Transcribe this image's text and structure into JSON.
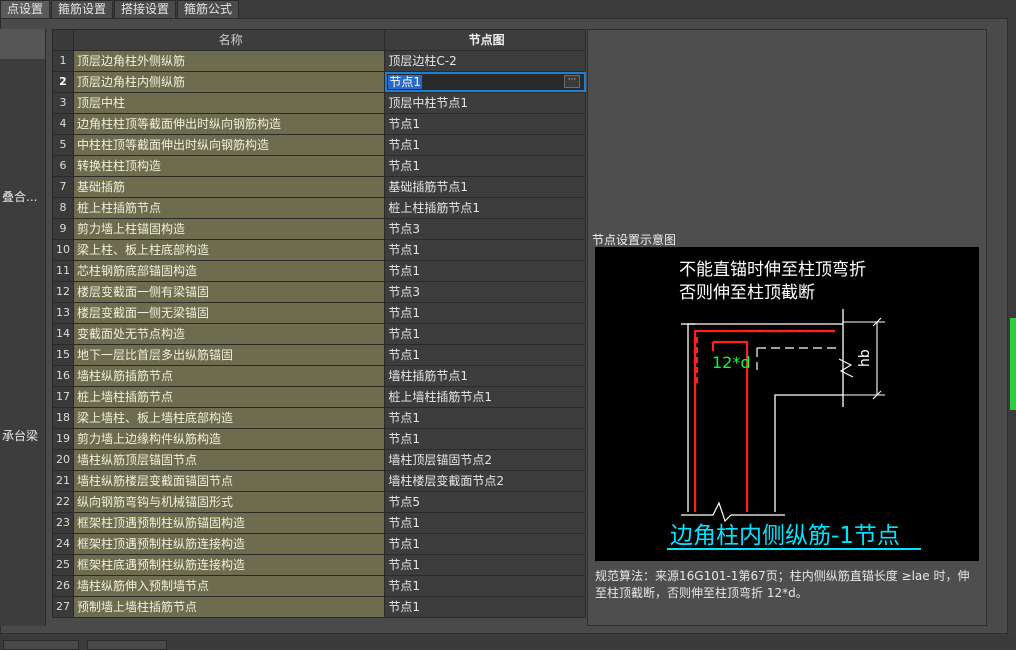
{
  "tabs": [
    "点设置",
    "箍筋设置",
    "搭接设置",
    "箍筋公式"
  ],
  "left_panel": {
    "item1": "叠合...",
    "item2": "承台梁"
  },
  "table": {
    "headers": {
      "num": "",
      "name": "名称",
      "node": "节点图"
    },
    "rows": [
      {
        "num": "1",
        "name": "顶层边角柱外侧纵筋",
        "node": "顶层边柱C-2"
      },
      {
        "num": "2",
        "name": "顶层边角柱内侧纵筋",
        "node": "节点1"
      },
      {
        "num": "3",
        "name": "顶层中柱",
        "node": "顶层中柱节点1"
      },
      {
        "num": "4",
        "name": "边角柱柱顶等截面伸出时纵向钢筋构造",
        "node": "节点1"
      },
      {
        "num": "5",
        "name": "中柱柱顶等截面伸出时纵向钢筋构造",
        "node": "节点1"
      },
      {
        "num": "6",
        "name": "转换柱柱顶构造",
        "node": "节点1"
      },
      {
        "num": "7",
        "name": "基础插筋",
        "node": "基础插筋节点1"
      },
      {
        "num": "8",
        "name": "桩上柱插筋节点",
        "node": "桩上柱插筋节点1"
      },
      {
        "num": "9",
        "name": "剪力墙上柱锚固构造",
        "node": "节点3"
      },
      {
        "num": "10",
        "name": "梁上柱、板上柱底部构造",
        "node": "节点1"
      },
      {
        "num": "11",
        "name": "芯柱钢筋底部锚固构造",
        "node": "节点1"
      },
      {
        "num": "12",
        "name": "楼层变截面一侧有梁锚固",
        "node": "节点3"
      },
      {
        "num": "13",
        "name": "楼层变截面一侧无梁锚固",
        "node": "节点1"
      },
      {
        "num": "14",
        "name": "变截面处无节点构造",
        "node": "节点1"
      },
      {
        "num": "15",
        "name": "地下一层比首层多出纵筋锚固",
        "node": "节点1"
      },
      {
        "num": "16",
        "name": "墙柱纵筋插筋节点",
        "node": "墙柱插筋节点1"
      },
      {
        "num": "17",
        "name": "桩上墙柱插筋节点",
        "node": "桩上墙柱插筋节点1"
      },
      {
        "num": "18",
        "name": "梁上墙柱、板上墙柱底部构造",
        "node": "节点1"
      },
      {
        "num": "19",
        "name": "剪力墙上边缘构件纵筋构造",
        "node": "节点1"
      },
      {
        "num": "20",
        "name": "墙柱纵筋顶层锚固节点",
        "node": "墙柱顶层锚固节点2"
      },
      {
        "num": "21",
        "name": "墙柱纵筋楼层变截面锚固节点",
        "node": "墙柱楼层变截面节点2"
      },
      {
        "num": "22",
        "name": "纵向钢筋弯钩与机械锚固形式",
        "node": "节点5"
      },
      {
        "num": "23",
        "name": "框架柱顶遇预制柱纵筋锚固构造",
        "node": "节点1"
      },
      {
        "num": "24",
        "name": "框架柱顶遇预制柱纵筋连接构造",
        "node": "节点1"
      },
      {
        "num": "25",
        "name": "框架柱底遇预制柱纵筋连接构造",
        "node": "节点1"
      },
      {
        "num": "26",
        "name": "墙柱纵筋伸入预制墙节点",
        "node": "节点1"
      },
      {
        "num": "27",
        "name": "预制墙上墙柱插筋节点",
        "node": "节点1"
      }
    ],
    "selected_row": 2
  },
  "diagram": {
    "panel_title": "节点设置示意图",
    "line1": "不能直锚时伸至柱顶弯折",
    "line2": "否则伸至柱顶截断",
    "label_12d": "12*d",
    "label_hb": "hb",
    "caption": "边角柱内侧纵筋-1节点",
    "colors": {
      "rebar": "#ff2020",
      "caption": "#00e5ff",
      "dim": "#00ff33",
      "line": "#ffffff"
    }
  },
  "note": "规范算法：来源16G101-1第67页；柱内侧纵筋直锚长度 ≥lae 时，伸至柱顶截断，否则伸至柱顶弯折 12*d。",
  "ellipsis_glyph": "···"
}
